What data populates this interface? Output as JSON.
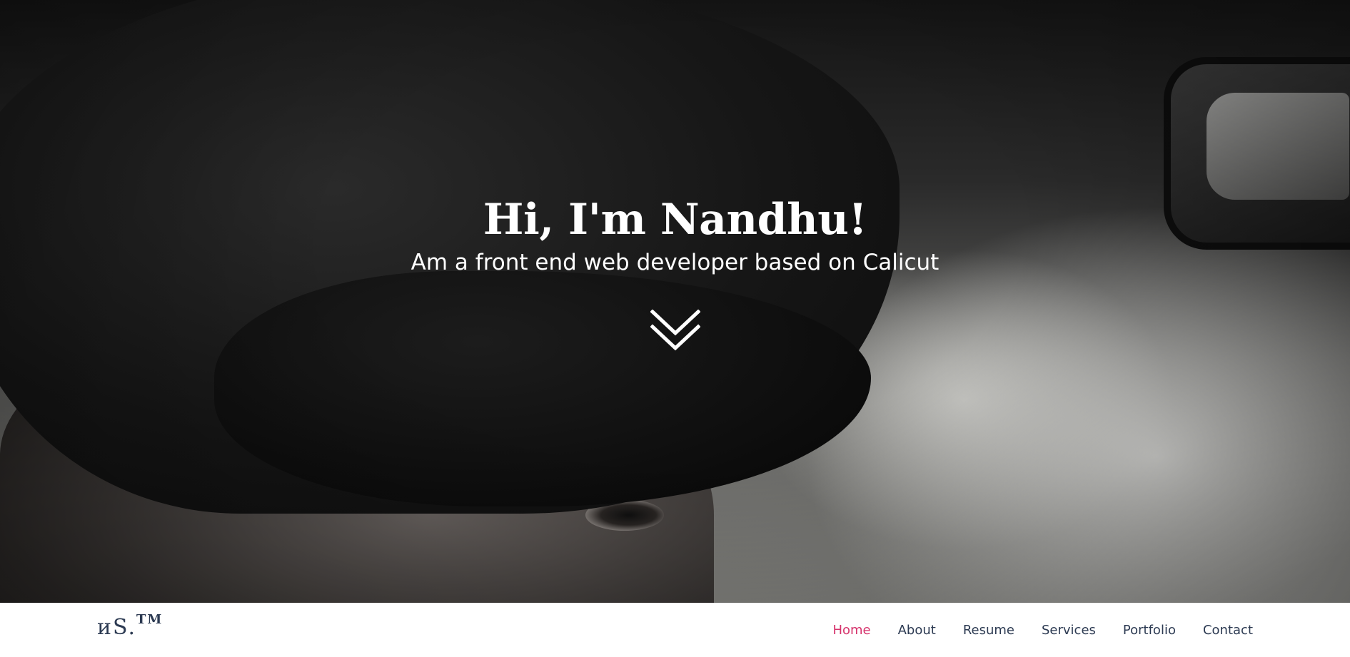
{
  "hero": {
    "title": "Hi, I'm Nandhu!",
    "subtitle": "Am a front end web developer based on Calicut",
    "scroll_icon": "double-chevron-down-icon"
  },
  "navbar": {
    "logo_text": "иS.",
    "logo_mark": "TM",
    "items": [
      {
        "label": "Home",
        "active": true
      },
      {
        "label": "About",
        "active": false
      },
      {
        "label": "Resume",
        "active": false
      },
      {
        "label": "Services",
        "active": false
      },
      {
        "label": "Portfolio",
        "active": false
      },
      {
        "label": "Contact",
        "active": false
      }
    ]
  },
  "colors": {
    "accent": "#d6336c",
    "nav_text": "#2c3a52",
    "hero_text": "#ffffff"
  }
}
